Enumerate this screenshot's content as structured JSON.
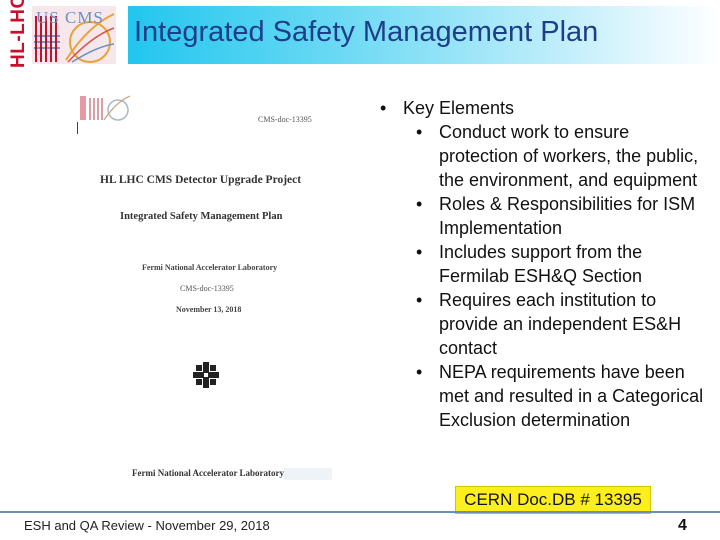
{
  "header": {
    "title": "Integrated Safety Management Plan",
    "logo_text": "HL-LHC",
    "logo_cms_text": "US CMS"
  },
  "document": {
    "header_ref": "CMS-doc-13395",
    "project_title": "HL LHC CMS Detector Upgrade Project",
    "plan_title": "Integrated Safety Management Plan",
    "lab": "Fermi National Accelerator Laboratory",
    "doc_number": "CMS-doc-13395",
    "date": "November 13, 2018",
    "bottom_lab": "Fermi National Accelerator Laboratory"
  },
  "bullets": {
    "main": "Key Elements",
    "items": [
      "Conduct work to ensure protection of workers, the public, the environment, and equipment",
      "Roles & Responsibilities for ISM Implementation",
      "Includes support from the Fermilab ESH&Q Section",
      "Requires each institution to provide an independent ES&H contact",
      "NEPA requirements have been met and resulted in a Categorical Exclusion determination"
    ]
  },
  "doc_db": "CERN Doc.DB # 13395",
  "footer": {
    "left": "ESH and QA Review - November 29, 2018",
    "page": "4"
  },
  "colors": {
    "title": "#1d3f8a",
    "header_band": "#22c6ee",
    "logo_red": "#c8102e",
    "highlight": "#fdee1e",
    "footer_line": "#6f8db3"
  }
}
